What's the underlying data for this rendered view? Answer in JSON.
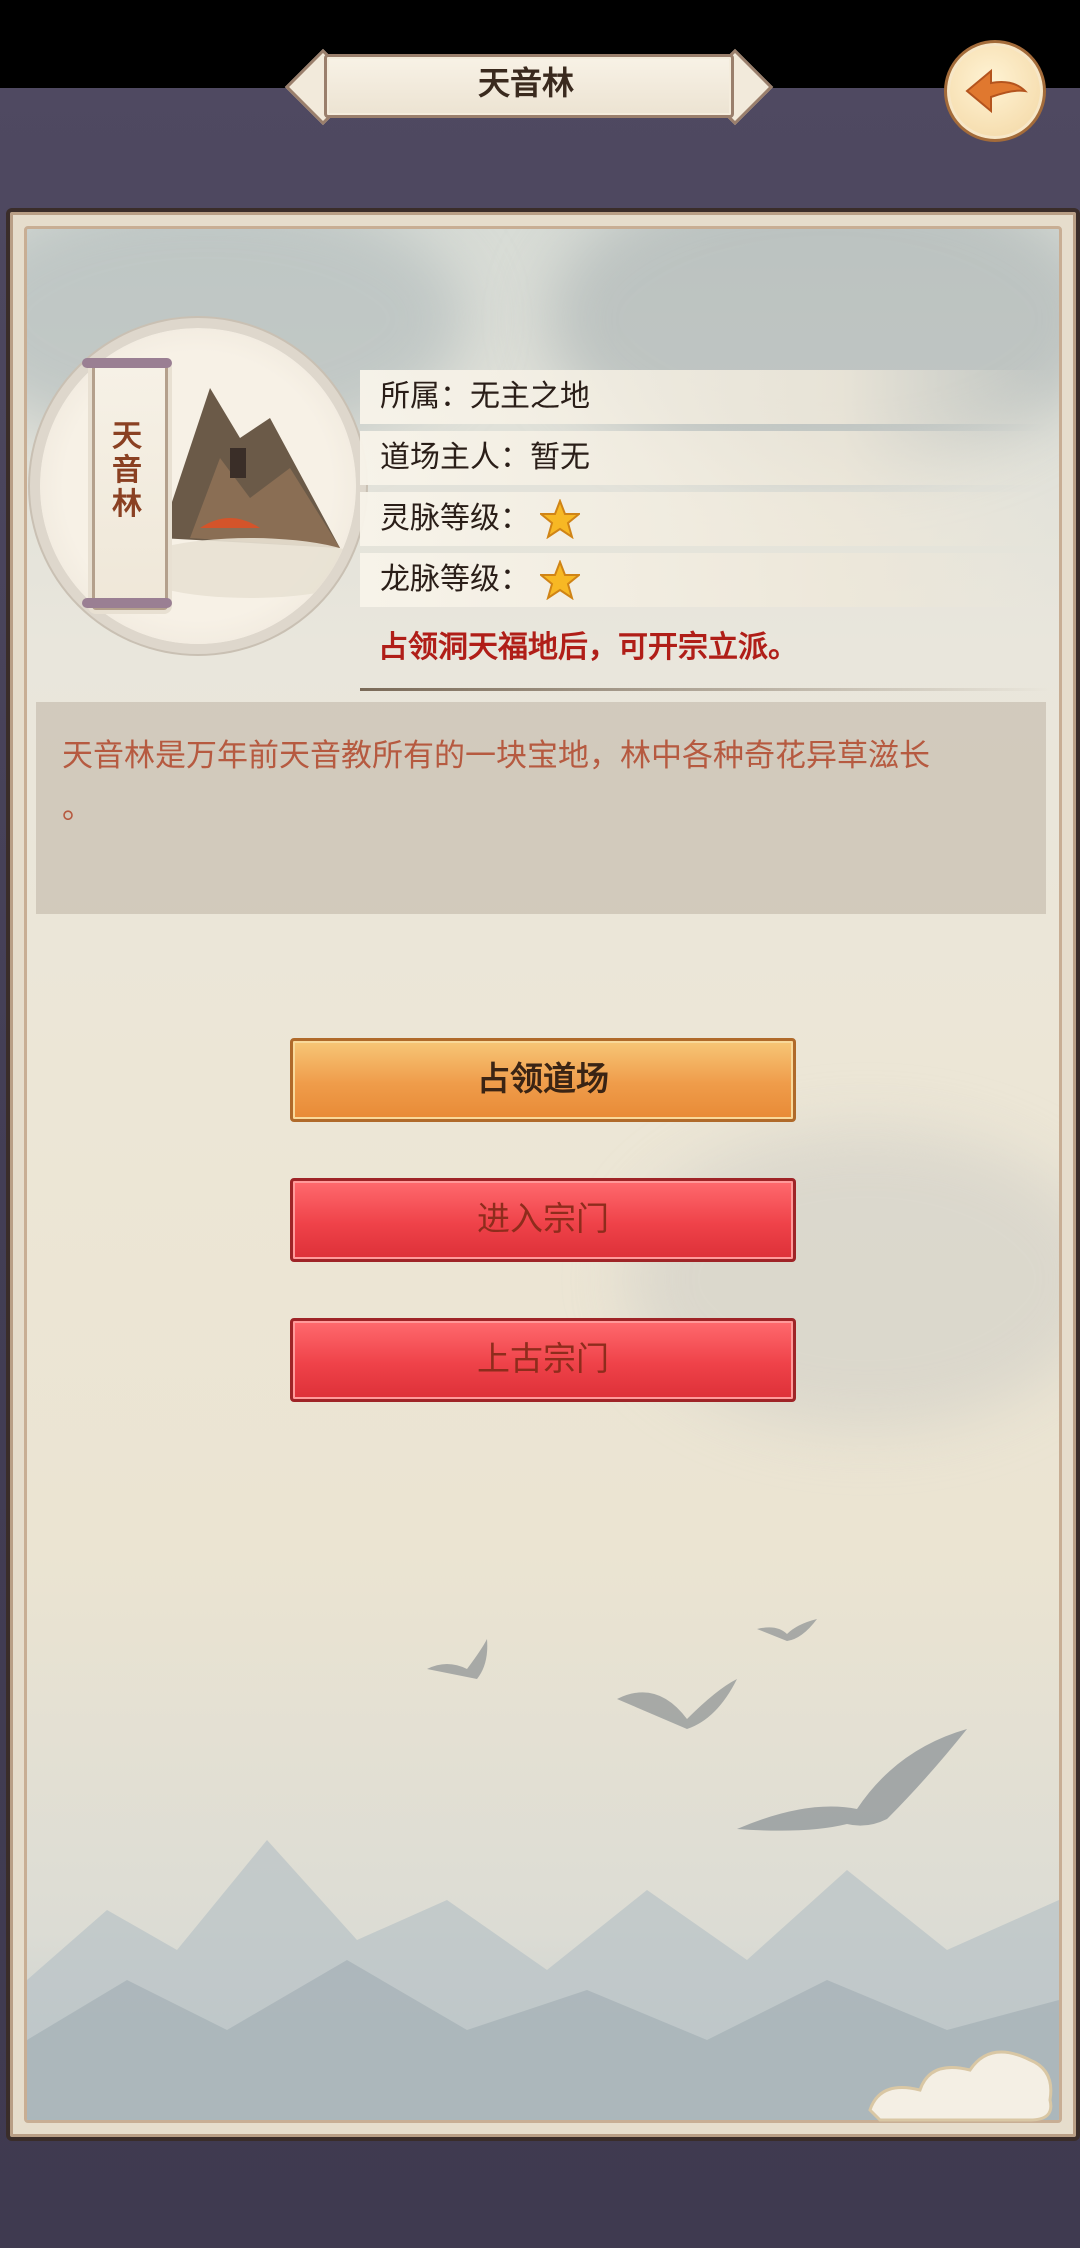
{
  "header": {
    "title": "天音林"
  },
  "banner": {
    "name_vertical": "天\n音\n林"
  },
  "info": {
    "affiliation": "所属：无主之地",
    "owner": "道场主人：暂无",
    "spirit_vein": "灵脉等级：",
    "dragon_vein": "龙脉等级：",
    "spirit_vein_stars": 1,
    "dragon_vein_stars": 1,
    "notice": "占领洞天福地后，可开宗立派。"
  },
  "description": "天音林是万年前天音教所有的一块宝地，林中各种奇花异草滋长\n。",
  "buttons": {
    "occupy": "占领道场",
    "enter_sect": "进入宗门",
    "ancient_sect": "上古宗门"
  },
  "colors": {
    "notice": "#b01e18",
    "description": "#b65a40",
    "occupy_button": "#ef9c4a",
    "red_button": "#ef4249"
  }
}
